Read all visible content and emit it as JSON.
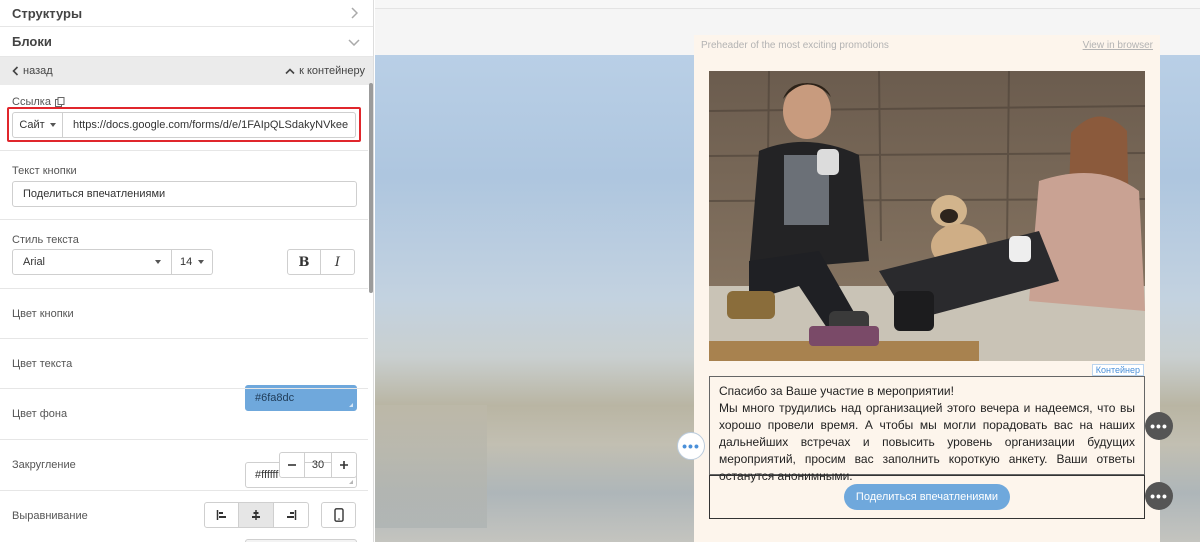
{
  "sidebar": {
    "structures_label": "Структуры",
    "blocks_label": "Блоки",
    "back_label": "назад",
    "to_container_label": "к контейнеру",
    "link": {
      "label": "Ссылка",
      "type_value": "Сайт",
      "url_value": "https://docs.google.com/forms/d/e/1FAIpQLSdakyNVkee"
    },
    "button_text": {
      "label": "Текст кнопки",
      "value": "Поделиться впечатлениями"
    },
    "text_style": {
      "label": "Стиль текста",
      "font_value": "Arial",
      "size_value": "14",
      "bold_label": "B",
      "italic_label": "I"
    },
    "button_color": {
      "label": "Цвет кнопки",
      "value": "#6fa8dc"
    },
    "text_color": {
      "label": "Цвет текста",
      "value": "#ffffff"
    },
    "bg_color": {
      "label": "Цвет фона",
      "value": "transparent"
    },
    "radius": {
      "label": "Закругление",
      "value": "30"
    },
    "alignment": {
      "label": "Выравнивание",
      "selected": "center"
    }
  },
  "email": {
    "preheader": "Preheader of the most exciting promotions",
    "view_in_browser": "View in browser",
    "container_tag": "Контейнер",
    "body_text_title": "Спасибо за Ваше участие в мероприятии!",
    "body_text": "Мы много трудились над организацией этого вечера и надеемся, что вы хорошо провели время. А чтобы мы могли порадовать вас на наших дальнейших встречах и повысить уровень организации будущих мероприятий, просим вас заполнить короткую анкету. Ваши ответы останутся анонимными.",
    "cta_label": "Поделиться впечатлениями"
  },
  "colors": {
    "accent": "#6fa8dc",
    "highlight": "#e0262c",
    "email_bg": "#fdf5ec"
  },
  "icons": [
    "chevron-right-icon",
    "chevron-down-icon",
    "chevron-left-icon",
    "chevron-up-icon",
    "copy-icon",
    "caret-down-icon",
    "minus-icon",
    "plus-icon",
    "align-left-icon",
    "align-center-icon",
    "align-right-icon",
    "mobile-icon",
    "more-dots-icon"
  ]
}
